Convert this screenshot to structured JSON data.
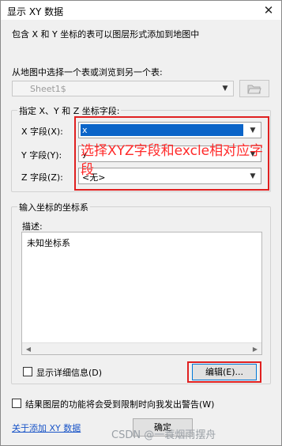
{
  "window": {
    "title": "显示 XY 数据",
    "close_glyph": "✕"
  },
  "intro_text": "包含 X 和 Y 坐标的表可以图层形式添加到地图中",
  "table_select": {
    "label": "从地图中选择一个表或浏览到另一个表:",
    "value": "Sheet1$",
    "browse_icon": "folder-open-icon"
  },
  "fields_group": {
    "title": "指定 X、Y 和 Z 坐标字段:",
    "x_label": "X 字段(X):",
    "x_value": "x",
    "y_label": "Y 字段(Y):",
    "y_value": "y",
    "z_label": "Z 字段(Z):",
    "z_value": "<无>"
  },
  "annotation": {
    "text": "选择XYZ字段和excle相对应字段",
    "color": "#e02020"
  },
  "coord_group": {
    "title": "输入坐标的坐标系",
    "description_label": "描述:",
    "description_text": "未知坐标系",
    "show_details_label": "显示详细信息(D)",
    "edit_button": "编辑(E)..."
  },
  "warn_checkbox_label": "结果图层的功能将会受到限制时向我发出警告(W)",
  "footer": {
    "link": "关于添加 XY 数据",
    "ok_button": "确定",
    "watermark": "CSDN @一蓑烟雨摆舟"
  },
  "colors": {
    "selection": "#0b64c8",
    "link": "#1a55c8",
    "annotation": "#e02020"
  }
}
